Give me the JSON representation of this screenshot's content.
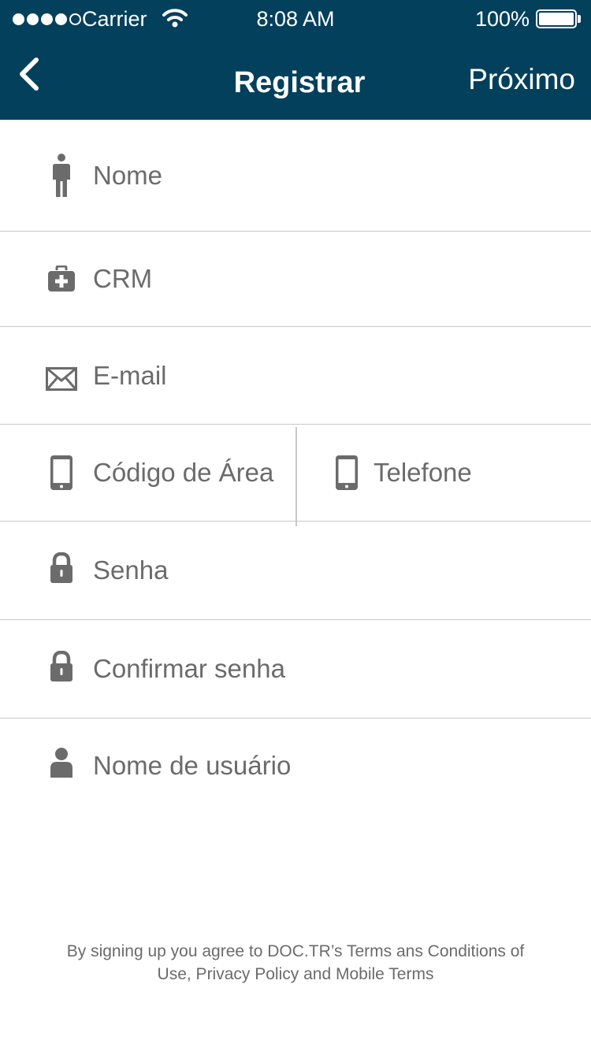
{
  "status_bar": {
    "carrier": "Carrier",
    "time": "8:08 AM",
    "battery": "100%"
  },
  "nav": {
    "title": "Registrar",
    "next_label": "Próximo",
    "back_icon": "chevron-left-icon"
  },
  "form": {
    "name_placeholder": "Nome",
    "crm_placeholder": "CRM",
    "email_placeholder": "E-mail",
    "area_code_placeholder": "Código de Área",
    "phone_placeholder": "Telefone",
    "password_placeholder": "Senha",
    "confirm_password_placeholder": "Confirmar senha",
    "username_placeholder": "Nome de usuário"
  },
  "legal": {
    "line1": "By signing up you agree to DOC.TR’s Terms ans Conditions of",
    "line2": "Use, Privacy Policy and Mobile Terms"
  },
  "colors": {
    "nav_background": "#03405c",
    "icon_gray": "#6b6b6b",
    "divider": "#c8c8c8"
  }
}
